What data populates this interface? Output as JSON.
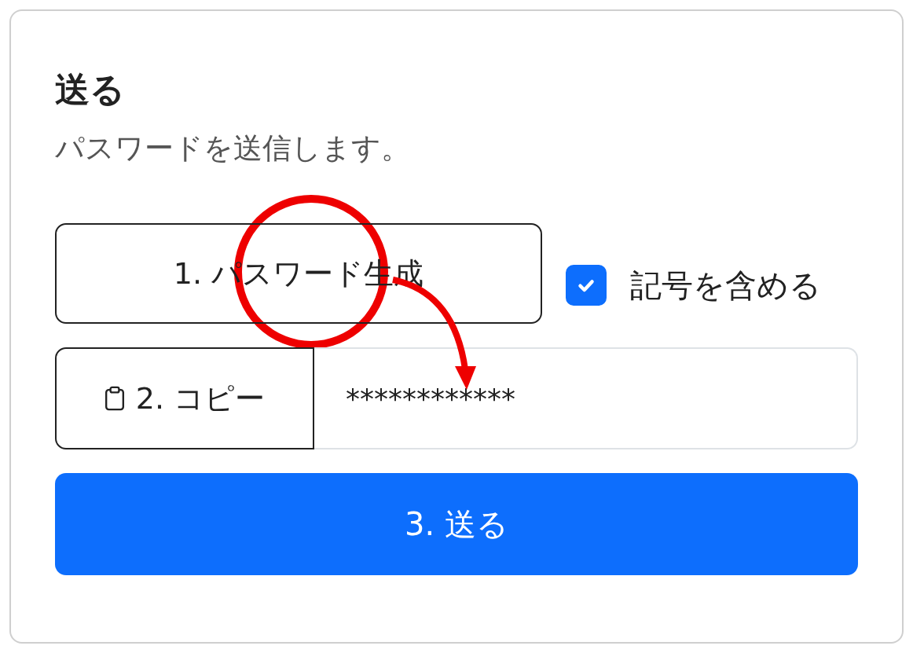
{
  "card": {
    "title": "送る",
    "subtitle": "パスワードを送信します。"
  },
  "generate_button": {
    "label": "1. パスワード生成"
  },
  "symbols_checkbox": {
    "label": "記号を含める",
    "checked": true
  },
  "copy_button": {
    "label": "2. コピー"
  },
  "password_field": {
    "value": "************"
  },
  "send_button": {
    "label": "3. 送る"
  }
}
